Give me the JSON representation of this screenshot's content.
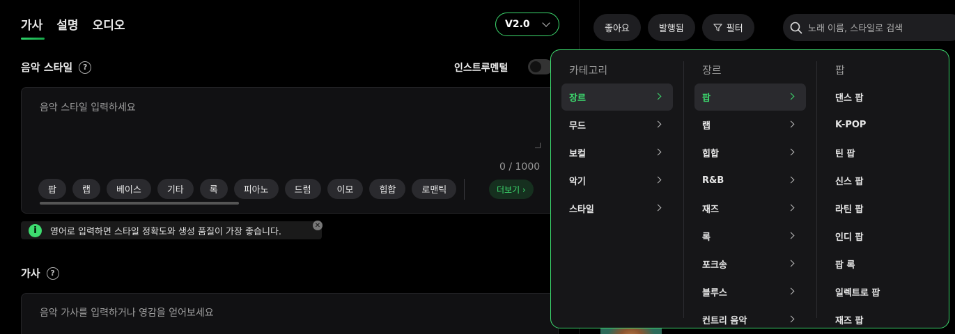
{
  "tabs": [
    {
      "label": "가사"
    },
    {
      "label": "설명"
    },
    {
      "label": "오디오"
    }
  ],
  "version": "V2.0",
  "music_style": {
    "label": "음악 스타일",
    "instrumental_label": "인스트루멘털",
    "placeholder": "음악 스타일 입력하세요",
    "counter": "0 / 1000",
    "chips": [
      "팝",
      "랩",
      "베이스",
      "기타",
      "록",
      "피아노",
      "드럼",
      "이모",
      "힙합",
      "로맨틱"
    ],
    "more_label": "더보기 ›"
  },
  "tip": {
    "icon": "i",
    "text": "영어로 입력하면 스타일 정확도와 생성 품질이 가장 좋습니다."
  },
  "lyrics": {
    "label": "가사",
    "placeholder": "음악 가사를 입력하거나 영감을 얻어보세요"
  },
  "right_bar": {
    "like_label": "좋아요",
    "published_label": "발행됨",
    "filter_label": "필터",
    "search_placeholder": "노래 이름, 스타일로 검색"
  },
  "dropdown": {
    "categories": {
      "title": "카테고리",
      "items": [
        "장르",
        "무드",
        "보컬",
        "악기",
        "스타일"
      ]
    },
    "genres": {
      "title": "장르",
      "items": [
        "팝",
        "랩",
        "힙합",
        "R&B",
        "재즈",
        "록",
        "포크송",
        "블루스",
        "컨트리 음악"
      ]
    },
    "pop": {
      "title": "팝",
      "items": [
        "댄스 팝",
        "K-POP",
        "틴 팝",
        "신스 팝",
        "라틴 팝",
        "인디 팝",
        "팝 록",
        "일렉트로 팝",
        "재즈 팝"
      ]
    },
    "accent": "#3ddc6f"
  }
}
